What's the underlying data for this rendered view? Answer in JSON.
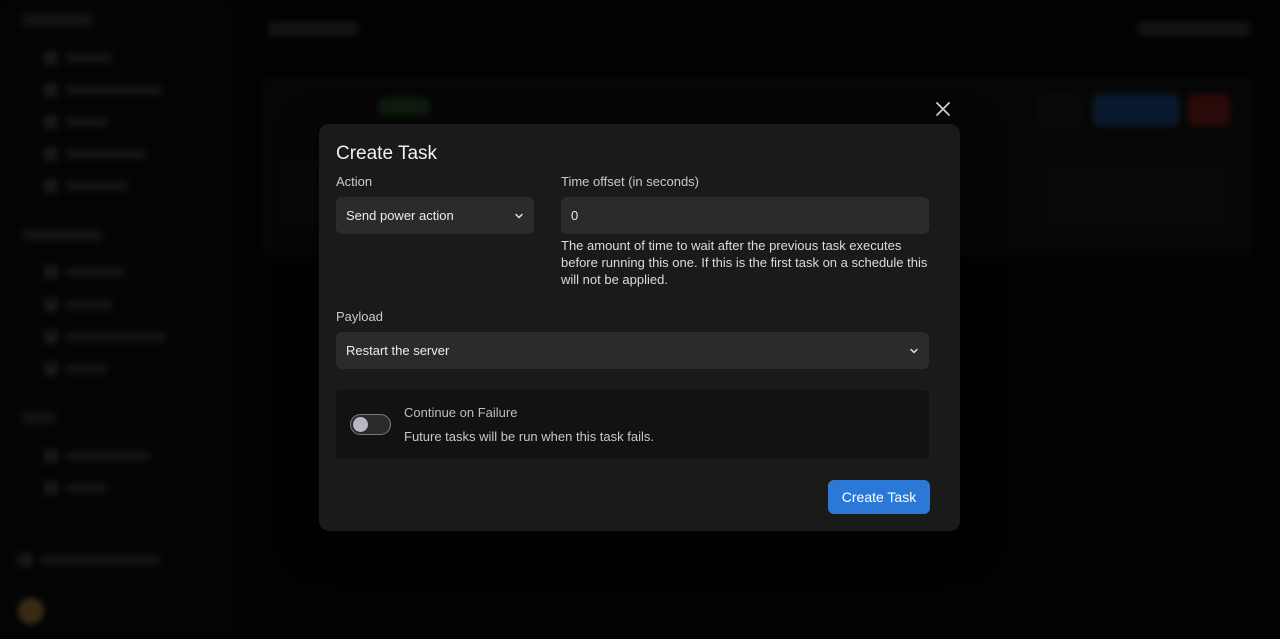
{
  "modal": {
    "title": "Create Task",
    "action_label": "Action",
    "action_value": "Send power action",
    "time_offset_label": "Time offset (in seconds)",
    "time_offset_value": "0",
    "time_offset_help": "The amount of time to wait after the previous task executes before running this one. If this is the first task on a schedule this will not be applied.",
    "payload_label": "Payload",
    "payload_value": "Restart the server",
    "continue_on_failure": {
      "title": "Continue on Failure",
      "description": "Future tasks will be run when this task fails.",
      "enabled": false
    },
    "submit_label": "Create Task"
  },
  "icons": {
    "close": "close-icon",
    "chevron": "chevron-down-icon"
  },
  "colors": {
    "accent": "#2b78d6",
    "modal_bg": "#1a1a1a",
    "field_bg": "#2b2b2b",
    "page_bg": "#050505"
  }
}
